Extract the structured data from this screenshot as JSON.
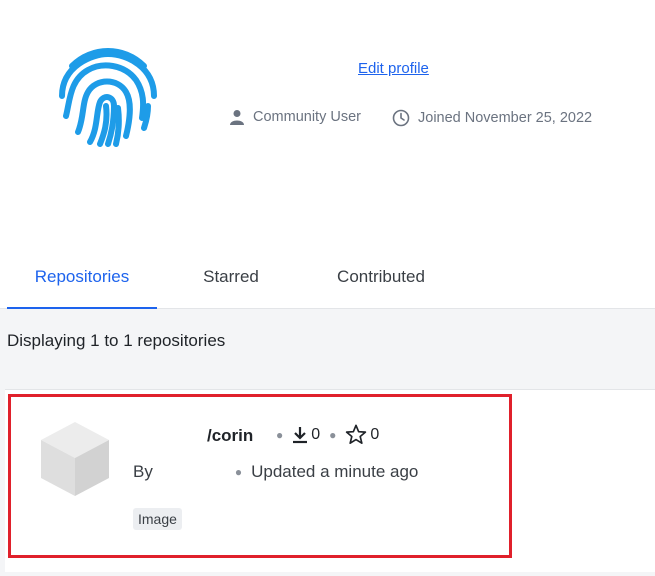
{
  "profile": {
    "edit_profile_label": "Edit profile",
    "role": "Community User",
    "joined": "Joined November 25, 2022"
  },
  "tabs": [
    {
      "label": "Repositories",
      "active": true
    },
    {
      "label": "Starred",
      "active": false
    },
    {
      "label": "Contributed",
      "active": false
    }
  ],
  "listing": {
    "summary": "Displaying 1 to 1 repositories"
  },
  "repositories": [
    {
      "name": "/corin",
      "pulls": "0",
      "stars": "0",
      "by_label": "By",
      "updated": "Updated a minute ago",
      "type_badge": "Image"
    }
  ],
  "colors": {
    "accent": "#1d63ed",
    "avatar": "#1e9ce8",
    "highlight": "#e0202b"
  },
  "icons": {
    "avatar": "fingerprint-icon",
    "role": "user-icon",
    "joined": "clock-icon",
    "pulls": "download-icon",
    "stars": "star-icon",
    "repo": "cube-icon"
  }
}
